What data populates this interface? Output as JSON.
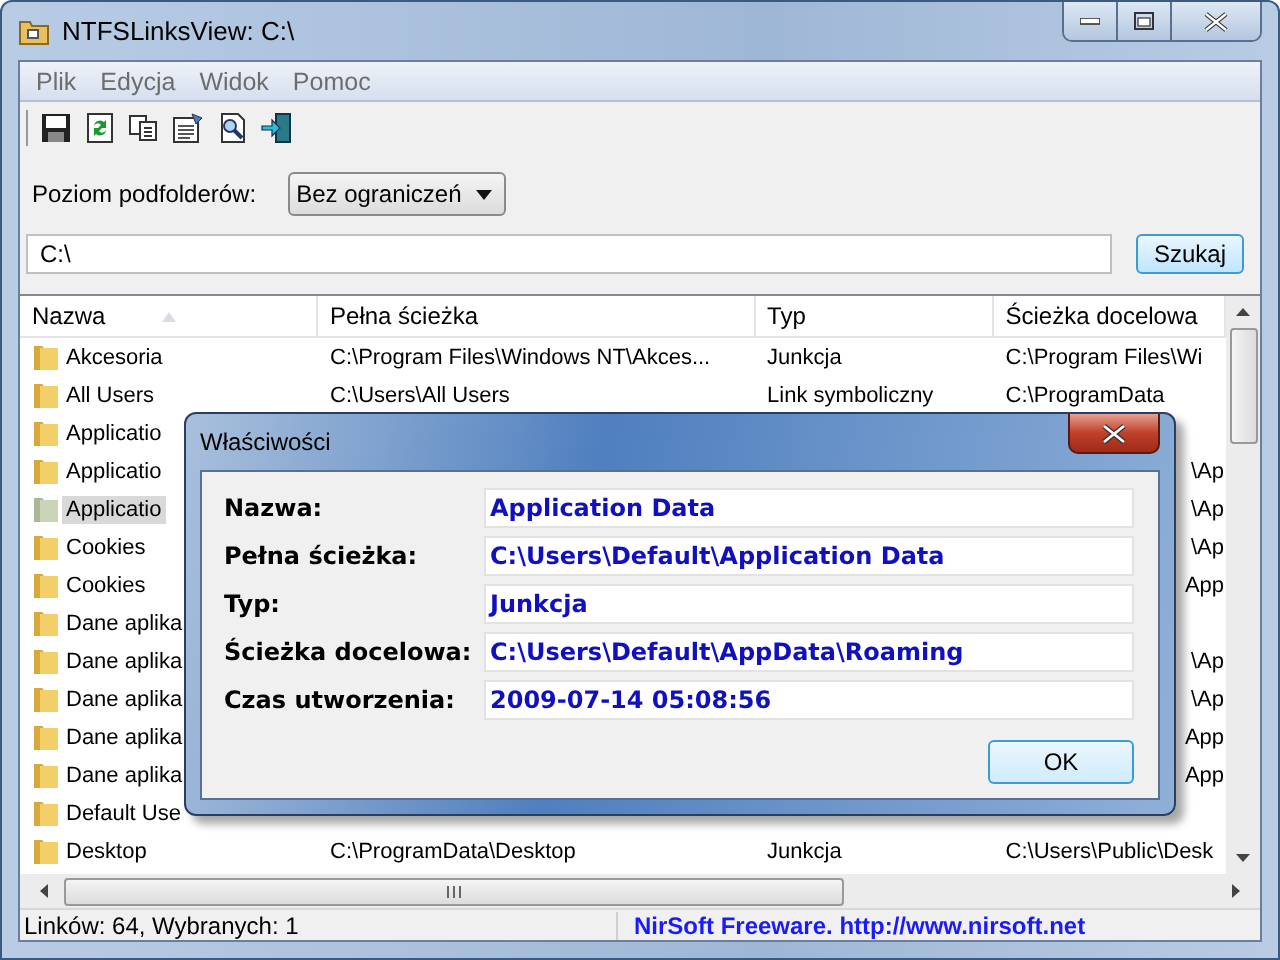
{
  "window": {
    "title": "NTFSLinksView:  C:\\"
  },
  "menu": [
    "Plik",
    "Edycja",
    "Widok",
    "Pomoc"
  ],
  "toolbar": [
    {
      "kind": "save"
    },
    {
      "kind": "refresh"
    },
    {
      "kind": "copy"
    },
    {
      "kind": "properties"
    },
    {
      "kind": "find"
    },
    {
      "kind": "exit"
    }
  ],
  "options": {
    "label": "Poziom podfolderów:",
    "dropdown": "Bez ograniczeń"
  },
  "path_field": {
    "value": "C:\\"
  },
  "search_button": "Szukaj",
  "table": {
    "columns": [
      {
        "label": "Nazwa",
        "sorted": true
      },
      {
        "label": "Pełna ścieżka",
        "sorted": false
      },
      {
        "label": "Typ",
        "sorted": false
      },
      {
        "label": "Ścieżka docelowa",
        "sorted": false
      }
    ],
    "rows": [
      {
        "kind": "full",
        "name": "Akcesoria",
        "path": "C:\\Program Files\\Windows NT\\Akces...",
        "type": "Junkcja",
        "target": "C:\\Program Files\\Wi",
        "selected": false
      },
      {
        "kind": "full",
        "name": "All Users",
        "path": "C:\\Users\\All Users",
        "type": "Link symboliczny",
        "target": "C:\\ProgramData",
        "selected": false
      },
      {
        "kind": "covered",
        "name": "Applicatio",
        "selected": false
      },
      {
        "kind": "covered",
        "name": "Applicatio",
        "target": "\\Ap",
        "selected": false
      },
      {
        "kind": "covered",
        "name": "Applicatio",
        "target": "\\Ap",
        "selected": true
      },
      {
        "kind": "covered",
        "name": "Cookies",
        "target": "\\Ap",
        "selected": false
      },
      {
        "kind": "covered",
        "name": "Cookies",
        "target": "App",
        "selected": false
      },
      {
        "kind": "covered",
        "name": "Dane aplika",
        "selected": false
      },
      {
        "kind": "covered",
        "name": "Dane aplika",
        "target": "\\Ap",
        "selected": false
      },
      {
        "kind": "covered",
        "name": "Dane aplika",
        "target": "\\Ap",
        "selected": false
      },
      {
        "kind": "covered",
        "name": "Dane aplika",
        "target": "App",
        "selected": false
      },
      {
        "kind": "covered",
        "name": "Dane aplika",
        "target": "App",
        "selected": false
      },
      {
        "kind": "covered",
        "name": "Default Use",
        "selected": false
      },
      {
        "kind": "full",
        "name": "Desktop",
        "path": "C:\\ProgramData\\Desktop",
        "type": "Junkcja",
        "target": "C:\\Users\\Public\\Desk",
        "selected": false
      }
    ]
  },
  "dialog": {
    "title": "Właściwości",
    "fields": [
      {
        "label": "Nazwa:",
        "value": "Application Data"
      },
      {
        "label": "Pełna ścieżka:",
        "value": "C:\\Users\\Default\\Application Data"
      },
      {
        "label": "Typ:",
        "value": "Junkcja"
      },
      {
        "label": "Ścieżka docelowa:",
        "value": "C:\\Users\\Default\\AppData\\Roaming"
      },
      {
        "label": "Czas utworzenia:",
        "value": "2009-07-14 05:08:56"
      }
    ],
    "ok_button": "OK"
  },
  "status_bar": {
    "left": "Linków: 64, Wybranych: 1",
    "right": "NirSoft Freeware.  http://www.nirsoft.net"
  }
}
